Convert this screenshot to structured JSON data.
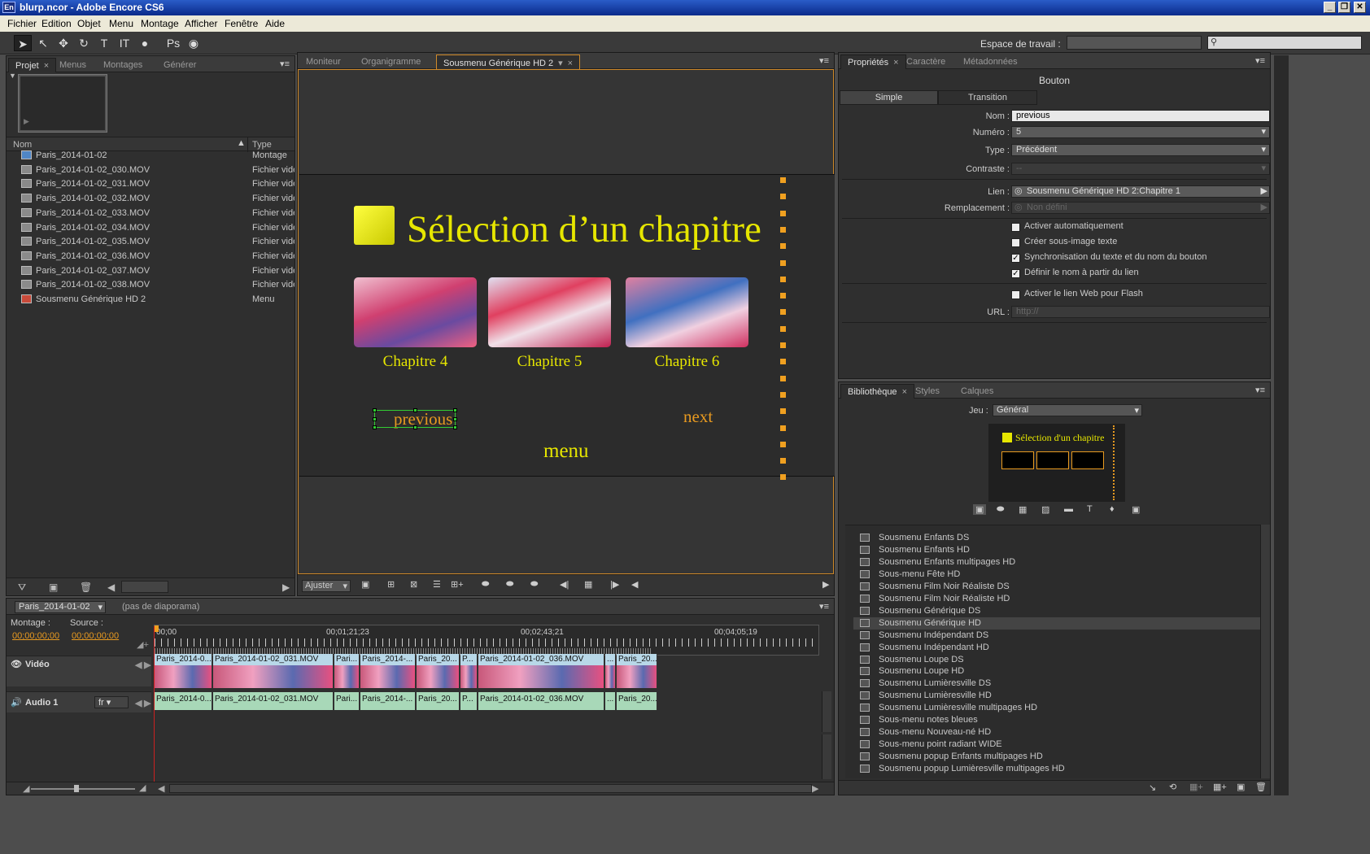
{
  "titlebar": {
    "title": "blurp.ncor - Adobe Encore CS6",
    "icon": "En"
  },
  "menubar": [
    "Fichier",
    "Edition",
    "Objet",
    "Menu",
    "Montage",
    "Afficher",
    "Fenêtre",
    "Aide"
  ],
  "toolbar": {
    "workspace_label": "Espace de travail :",
    "workspace_value": ""
  },
  "project": {
    "tabs": [
      "Projet",
      "Menus",
      "Montages",
      "Générer"
    ],
    "columns": {
      "name": "Nom",
      "type": "Type"
    },
    "items": [
      {
        "name": "Paris_2014-01-02",
        "type": "Montage",
        "icon": "montage-icon"
      },
      {
        "name": "Paris_2014-01-02_030.MOV",
        "type": "Fichier vidé",
        "icon": "video-file-icon"
      },
      {
        "name": "Paris_2014-01-02_031.MOV",
        "type": "Fichier vidé",
        "icon": "video-file-icon"
      },
      {
        "name": "Paris_2014-01-02_032.MOV",
        "type": "Fichier vidé",
        "icon": "video-file-icon"
      },
      {
        "name": "Paris_2014-01-02_033.MOV",
        "type": "Fichier vidé",
        "icon": "video-file-icon"
      },
      {
        "name": "Paris_2014-01-02_034.MOV",
        "type": "Fichier vidé",
        "icon": "video-file-icon"
      },
      {
        "name": "Paris_2014-01-02_035.MOV",
        "type": "Fichier vidé",
        "icon": "video-file-icon"
      },
      {
        "name": "Paris_2014-01-02_036.MOV",
        "type": "Fichier vidé",
        "icon": "video-file-icon"
      },
      {
        "name": "Paris_2014-01-02_037.MOV",
        "type": "Fichier vidé",
        "icon": "video-file-icon"
      },
      {
        "name": "Paris_2014-01-02_038.MOV",
        "type": "Fichier vidé",
        "icon": "video-file-icon"
      },
      {
        "name": "Sousmenu Générique HD 2",
        "type": "Menu",
        "icon": "menu-icon"
      }
    ]
  },
  "viewer": {
    "tabs": [
      "Moniteur",
      "Organigramme",
      "Sousmenu Générique HD 2"
    ],
    "menu_title": "Sélection d’un chapitre",
    "chapters": [
      "Chapitre 4",
      "Chapitre 5",
      "Chapitre 6"
    ],
    "prev": "previous",
    "next": "next",
    "menu": "menu",
    "zoom": "Ajuster"
  },
  "timeline": {
    "sequence": "Paris_2014-01-02",
    "slideshow": "(pas de diaporama)",
    "montage_label": "Montage :",
    "source_label": "Source :",
    "montage_time": "00;00;00;00",
    "source_time": "00;00;00;00",
    "ruler": [
      "00;00",
      "00;01;21;23",
      "00;02;43;21",
      "00;04;05;19"
    ],
    "video_track": "Vidéo",
    "audio_track": "Audio 1",
    "audio_lang": "fr",
    "clips": [
      "Paris_2014-0...",
      "Paris_2014-01-02_031.MOV",
      "Pari...",
      "Paris_2014-...",
      "Paris_20...",
      "P...",
      "Paris_2014-01-02_036.MOV",
      "...",
      "Paris_20..."
    ]
  },
  "properties": {
    "tabs": [
      "Propriétés",
      "Caractère",
      "Métadonnées"
    ],
    "title": "Bouton",
    "subtabs": [
      "Simple",
      "Transition"
    ],
    "nom_label": "Nom :",
    "nom": "previous",
    "numero_label": "Numéro :",
    "numero": "5",
    "type_label": "Type :",
    "type": "Précédent",
    "contraste_label": "Contraste :",
    "contraste": "--",
    "lien_label": "Lien :",
    "lien": "Sousmenu Générique HD 2:Chapitre 1",
    "remplacement_label": "Remplacement :",
    "remplacement": "Non défini",
    "checks": [
      {
        "label": "Activer automatiquement",
        "checked": false
      },
      {
        "label": "Créer sous-image texte",
        "checked": false
      },
      {
        "label": "Synchronisation du texte et du nom du bouton",
        "checked": true
      },
      {
        "label": "Définir le nom à partir du lien",
        "checked": true
      }
    ],
    "flash_label": "Activer le lien Web pour Flash",
    "url_label": "URL :",
    "url": "http://"
  },
  "library": {
    "tabs": [
      "Bibliothèque",
      "Styles",
      "Calques"
    ],
    "jeu_label": "Jeu :",
    "jeu": "Général",
    "preview_title": "Sélection d'un chapitre",
    "items": [
      "Sousmenu Enfants DS",
      "Sousmenu Enfants HD",
      "Sousmenu Enfants multipages HD",
      "Sous-menu Fête HD",
      "Sousmenu Film Noir Réaliste DS",
      "Sousmenu Film Noir Réaliste HD",
      "Sousmenu Générique DS",
      "Sousmenu Générique HD",
      "Sousmenu Indépendant DS",
      "Sousmenu Indépendant HD",
      "Sousmenu Loupe DS",
      "Sousmenu Loupe HD",
      "Sousmenu Lumièresville DS",
      "Sousmenu Lumièresville HD",
      "Sousmenu Lumièresville multipages HD",
      "Sous-menu notes bleues",
      "Sous-menu Nouveau-né HD",
      "Sous-menu point radiant WIDE",
      "Sousmenu popup Enfants multipages HD",
      "Sousmenu popup Lumièresville multipages HD"
    ],
    "selected": "Sousmenu Générique HD"
  }
}
